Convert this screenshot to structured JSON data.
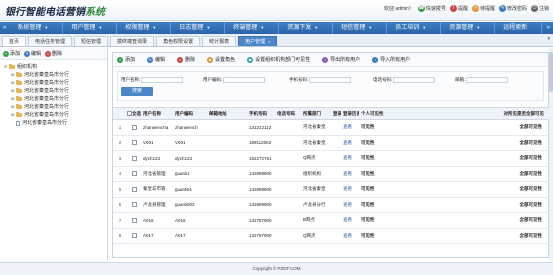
{
  "header": {
    "logo_main": "银行智能电话营销",
    "logo_accent": "系统",
    "welcome": "欢迎 admin！",
    "links": [
      {
        "label": "快速拨号",
        "icon": "phone-icon",
        "color": "#3c9d4a"
      },
      {
        "label": "提醒",
        "icon": "bell-icon",
        "color": "#d0463f"
      },
      {
        "label": "待提醒",
        "icon": "clock-icon",
        "color": "#e58f2b"
      },
      {
        "label": "修改密码",
        "icon": "key-icon",
        "color": "#3d79c0"
      },
      {
        "label": "注销",
        "icon": "power-icon",
        "color": "#666666"
      }
    ]
  },
  "mainnav": {
    "left_btn": "«",
    "right_btn": "»",
    "items": [
      "系统管理",
      "用户管理",
      "权限管理",
      "日志管理",
      "终端管理",
      "资源下发",
      "短信管理",
      "员工培训",
      "资源管理",
      "远程更新"
    ]
  },
  "tabs": {
    "items": [
      {
        "label": "首页",
        "kind": "home"
      },
      {
        "label": "电话任务管理",
        "kind": "normal"
      },
      {
        "label": "短信管理",
        "kind": "normal"
      },
      {
        "label": "拨终端查询录",
        "kind": "normal"
      },
      {
        "label": "角色权限设置",
        "kind": "normal"
      },
      {
        "label": "统计报表",
        "kind": "normal"
      },
      {
        "label": "用户管理",
        "kind": "active"
      }
    ],
    "close_glyph": "×"
  },
  "left": {
    "toolbar": [
      {
        "label": "添加",
        "icon": "add-icon",
        "color": "#3c9d4a"
      },
      {
        "label": "编辑",
        "icon": "edit-icon",
        "color": "#3d79c0"
      },
      {
        "label": "删除",
        "icon": "delete-icon",
        "color": "#d0463f"
      }
    ],
    "tree_root": "组织机构",
    "tree_children": [
      "河北省秦皇岛市分行",
      "河北省秦皇岛市分行",
      "河北省秦皇岛市分行",
      "河北省秦皇岛市分行",
      "河北省秦皇岛市分行",
      "河北省秦皇岛市分行",
      "河北省秦皇岛市分行"
    ]
  },
  "right": {
    "toolbar": [
      {
        "label": "添加",
        "icon": "add-icon",
        "color": "#3c9d4a"
      },
      {
        "label": "编辑",
        "icon": "edit-icon",
        "color": "#3d79c0"
      },
      {
        "label": "删除",
        "icon": "delete-icon",
        "color": "#d0463f"
      },
      {
        "label": "设置角色",
        "icon": "role-icon",
        "color": "#e58f2b"
      },
      {
        "label": "设置组织机构部门可见性",
        "icon": "eye-icon",
        "color": "#2a9fa5"
      },
      {
        "label": "导出所有用户",
        "icon": "export-icon",
        "color": "#8a5bc2"
      },
      {
        "label": "导入所有用户",
        "icon": "import-icon",
        "color": "#3d79c0"
      }
    ],
    "search": {
      "fields": [
        "用户名称:",
        "用户编码:",
        "手机号码:",
        "电话号码:",
        "邮箱:"
      ],
      "button": "搜索"
    },
    "columns": [
      "",
      "全选",
      "用户名称",
      "用户编码",
      "邮箱地址",
      "手机号码",
      "电话号码",
      "所属部门",
      "登录",
      "登录历史",
      "个人可见性",
      "",
      "",
      "",
      "",
      "",
      "",
      "",
      "对所见是否全部可见"
    ],
    "rows": [
      {
        "num": "1",
        "name": "zhanwencha",
        "code": "zhanwench",
        "email": "",
        "mobile": "131212112",
        "phone": "",
        "dept": "河北省秦皇",
        "history": "查看",
        "visibility": "可见性",
        "all": "全部可见性"
      },
      {
        "num": "2",
        "name": "V001",
        "code": "V001",
        "email": "",
        "mobile": "189112062",
        "phone": "",
        "dept": "河北省秦皇",
        "history": "查看",
        "visibility": "可见性",
        "all": "全部可见性"
      },
      {
        "num": "3",
        "name": "dych123",
        "code": "dych123",
        "email": "",
        "mobile": "152272761",
        "phone": "",
        "dept": "Q网点",
        "history": "查看",
        "visibility": "可见性",
        "all": "全部可见性"
      },
      {
        "num": "4",
        "name": "河北省管理",
        "code": "guanli1",
        "email": "",
        "mobile": "132899900",
        "phone": "",
        "dept": "组织机构",
        "history": "查看",
        "visibility": "可见性",
        "all": "全部可见性"
      },
      {
        "num": "5",
        "name": "秦皇岛市管",
        "code": "guanli01",
        "email": "",
        "mobile": "132899900",
        "phone": "",
        "dept": "河北省秦皇",
        "history": "查看",
        "visibility": "可见性",
        "all": "全部可见性"
      },
      {
        "num": "6",
        "name": "卢龙县管理",
        "code": "guanli002",
        "email": "",
        "mobile": "132899900",
        "phone": "",
        "dept": "卢龙县分行",
        "history": "查看",
        "visibility": "可见性",
        "all": "全部可见性"
      },
      {
        "num": "7",
        "name": "A018",
        "code": "A018",
        "email": "",
        "mobile": "132787900",
        "phone": "",
        "dept": "B网点",
        "history": "查看",
        "visibility": "可见性",
        "all": "全部可见性"
      },
      {
        "num": "8",
        "name": "A017",
        "code": "A017",
        "email": "",
        "mobile": "132787900",
        "phone": "",
        "dept": "Q网点",
        "history": "查看",
        "visibility": "可见性",
        "all": "全部可见性"
      }
    ]
  },
  "footer": {
    "text": "Copyright © PZDF.COM"
  }
}
